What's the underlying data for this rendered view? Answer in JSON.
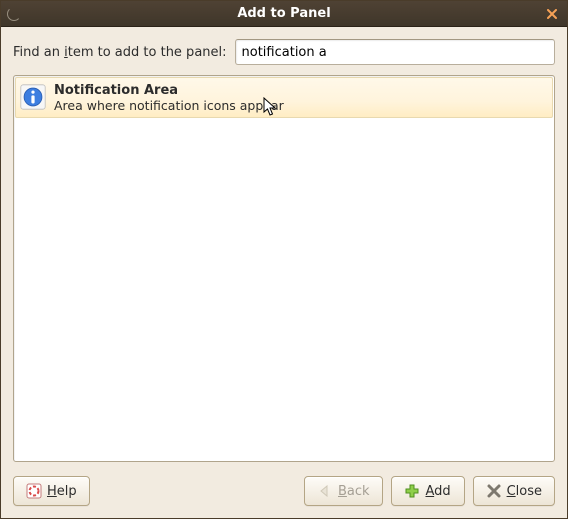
{
  "window": {
    "title": "Add to Panel"
  },
  "search": {
    "label_pre": "Find an ",
    "label_mn": "i",
    "label_post": "tem to add to the panel:",
    "value": "notification a"
  },
  "list": {
    "items": [
      {
        "title": "Notification Area",
        "description": "Area where notification icons appear"
      }
    ]
  },
  "buttons": {
    "help_mn": "H",
    "help_rest": "elp",
    "back_mn": "B",
    "back_rest": "ack",
    "add_mn": "A",
    "add_rest": "dd",
    "close_mn": "C",
    "close_rest": "lose"
  }
}
